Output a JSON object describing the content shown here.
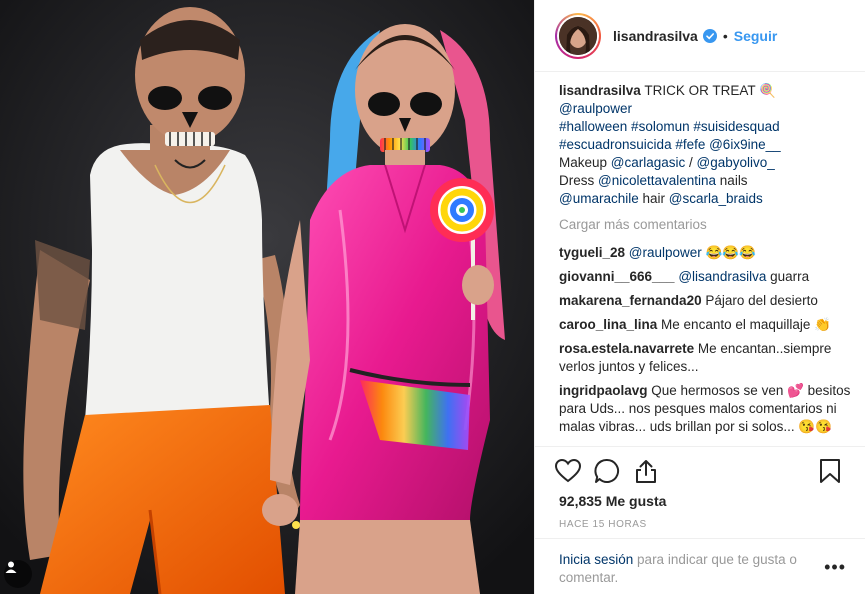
{
  "post": {
    "username": "lisandrasilva",
    "separator": "•",
    "follow_label": "Seguir",
    "caption": {
      "username": "lisandrasilva",
      "line1_text": "TRICK OR TREAT 🍭",
      "line2": "@raulpower",
      "line3": "#halloween #solomun #suisidesquad",
      "line4": "#escuadronsuicida #fefe @6ix9ine__",
      "line5_prefix": "Makeup ",
      "line5_link1": "@carlagasic",
      "line5_mid": " / ",
      "line5_link2": "@gabyolivo_",
      "line6_prefix": "Dress ",
      "line6_link": "@nicolettavalentina",
      "line6_suffix": " nails",
      "line7_link1": "@umarachile",
      "line7_mid": " hair ",
      "line7_link2": "@scarla_braids"
    },
    "load_more": "Cargar más comentarios",
    "comments": [
      {
        "user": "tygueli_28",
        "link": "@raulpower",
        "text": " 😂😂😂"
      },
      {
        "user": "giovanni__666___",
        "link": "@lisandrasilva",
        "text": " guarra"
      },
      {
        "user": "makarena_fernanda20",
        "link": "",
        "text": " Pájaro del desierto"
      },
      {
        "user": "caroo_lina_lina",
        "link": "",
        "text": " Me encanto el maquillaje 👏"
      },
      {
        "user": "rosa.estela.navarrete",
        "link": "",
        "text": " Me encantan..siempre verlos juntos y felices..."
      },
      {
        "user": "ingridpaolavg",
        "link": "",
        "text": " Que hermosos se ven 💕 besitos para Uds... nos pesques malos comentarios ni malas vibras... uds brillan por si solos... 😘😘"
      }
    ],
    "likes": "92,835 Me gusta",
    "timestamp": "HACE 15 HORAS",
    "login_link": "Inicia sesión",
    "login_text": " para indicar que te gusta o comentar.",
    "more_label": "•••"
  },
  "icons": {
    "like": "heart-icon",
    "comment": "comment-bubble-icon",
    "share": "share-icon",
    "save": "bookmark-icon",
    "verified": "verified-badge-icon",
    "tag": "user-tag-icon"
  },
  "colors": {
    "link": "#003569",
    "follow": "#3897f0",
    "muted": "#999999",
    "verified": "#3897f0"
  }
}
